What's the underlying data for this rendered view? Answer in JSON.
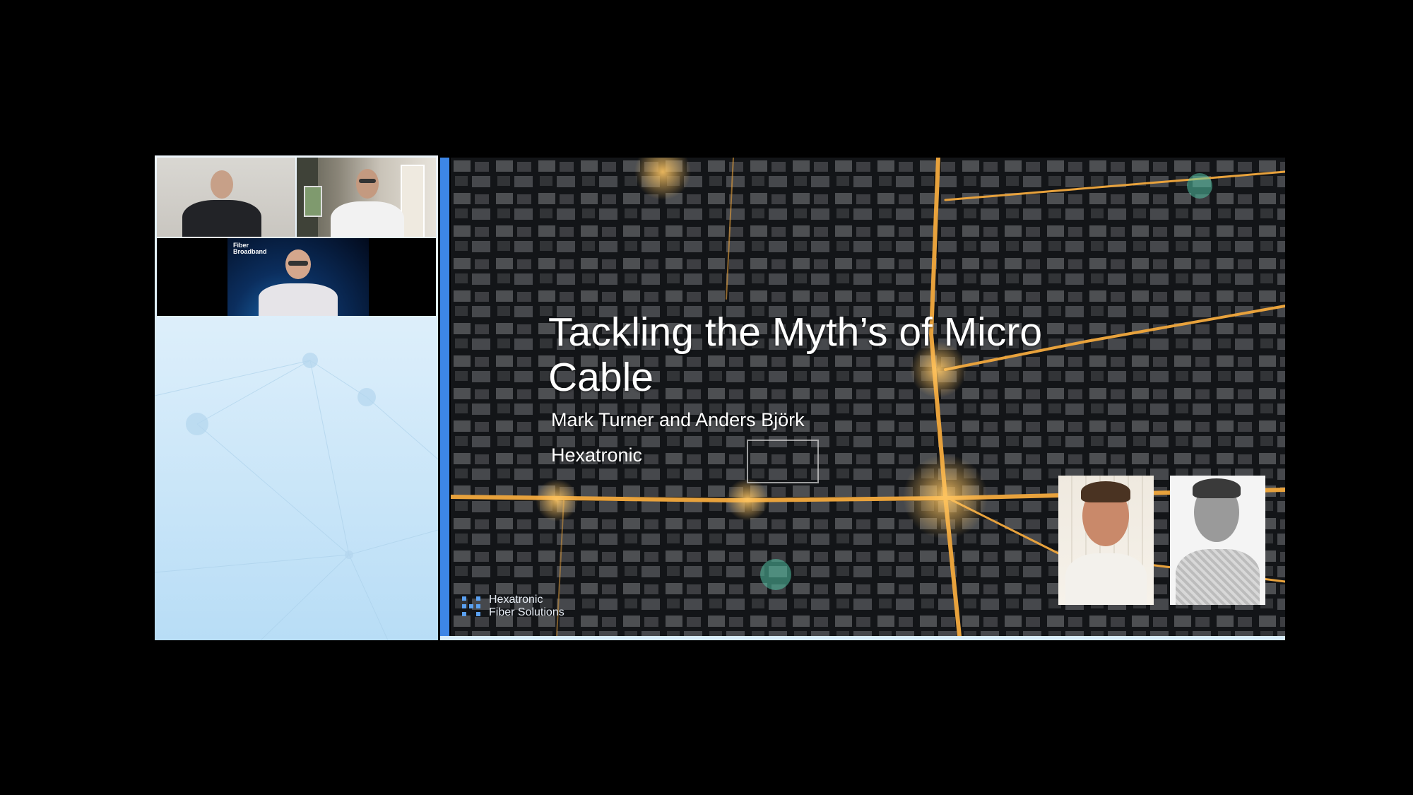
{
  "slide": {
    "title_line1": "Tackling the Myth’s of Micro",
    "title_line2": "Cable",
    "presenters": "Mark Turner and Anders Björk",
    "company": "Hexatronic",
    "logo_line1": "Hexatronic",
    "logo_line2": "Fiber Solutions"
  },
  "participants": [
    {
      "icon": "participant-video"
    },
    {
      "icon": "participant-video"
    },
    {
      "icon": "participant-video",
      "overlay_text": "Fiber Broadband"
    }
  ],
  "colors": {
    "accent_divider": "#3d86e6",
    "left_panel_top": "#eef6fc",
    "left_panel_bottom": "#b8ddf6",
    "street_light": "#f0b347",
    "slide_text": "#ffffff"
  }
}
